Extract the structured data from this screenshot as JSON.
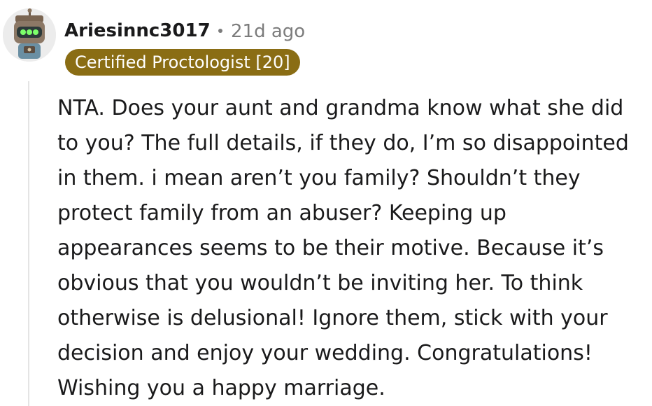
{
  "comment": {
    "author": {
      "username": "Ariesinnc3017",
      "avatar": "robot-avatar-icon",
      "flair": "Certified Proctologist [20]"
    },
    "timestamp": "21d ago",
    "body": "NTA. Does your aunt and grandma know what she did\nto you? The full details, if they do, I’m so disappointed\nin them. i mean aren’t you family? Shouldn’t they\nprotect family from an abuser? Keeping up\nappearances seems to be their motive. Because it’s\nobvious that you wouldn’t be inviting her. To think\notherwise is delusional! Ignore them, stick with your\ndecision and enjoy your wedding. Congratulations!\nWishing you a happy marriage."
  },
  "colors": {
    "flair_background": "#8a6d14",
    "flair_text": "#ffffff",
    "meta_text": "#7c7c7c",
    "thread_line": "#e4e4e4",
    "body_text": "#1a1a1b"
  }
}
